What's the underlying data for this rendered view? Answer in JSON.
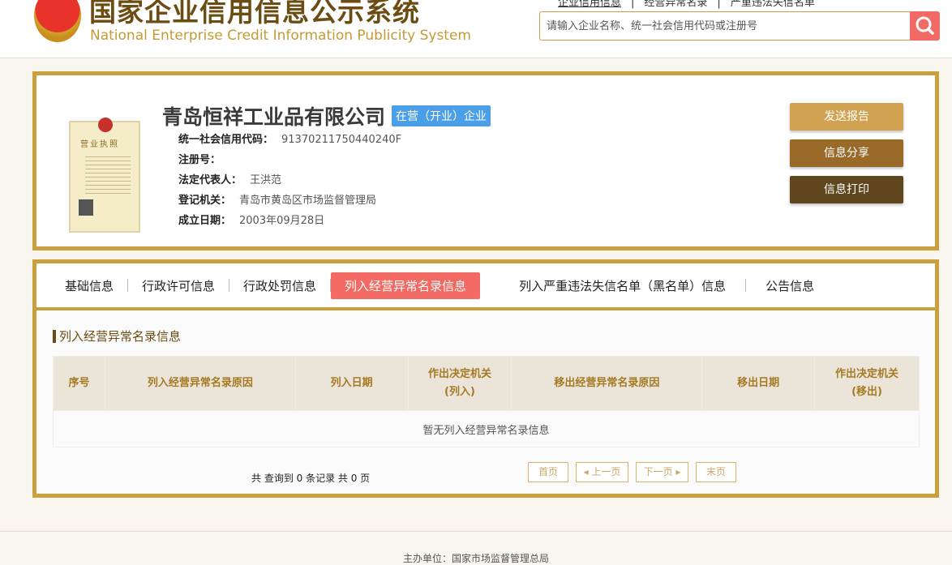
{
  "header": {
    "title_cn": "国家企业信用信息公示系统",
    "title_en": "National Enterprise Credit Information Publicity System",
    "links": [
      "企业信用信息",
      "经营异常名录",
      "严重违法失信名单"
    ],
    "search_placeholder": "请输入企业名称、统一社会信用代码或注册号"
  },
  "company": {
    "license_title": "营业执照",
    "name": "青岛恒祥工业品有限公司",
    "status": "在营（开业）企业",
    "fields": [
      {
        "label": "统一社会信用代码：",
        "value": "91370211750440240F"
      },
      {
        "label": "注册号：",
        "value": ""
      },
      {
        "label": "法定代表人：",
        "value": "王洪范"
      },
      {
        "label": "登记机关：",
        "value": "青岛市黄岛区市场监督管理局"
      },
      {
        "label": "成立日期：",
        "value": "2003年09月28日"
      }
    ],
    "buttons": [
      "发送报告",
      "信息分享",
      "信息打印"
    ]
  },
  "tabs": [
    "基础信息",
    "行政许可信息",
    "行政处罚信息",
    "列入经营异常名录信息",
    "列入严重违法失信名单（黑名单）信息",
    "公告信息"
  ],
  "section": {
    "title": "列入经营异常名录信息",
    "columns": [
      "序号",
      "列入经营异常名录原因",
      "列入日期",
      "作出决定机关\n(列入)",
      "移出经营异常名录原因",
      "移出日期",
      "作出决定机关\n(移出)"
    ],
    "empty": "暂无列入经营异常名录信息"
  },
  "pagination": {
    "summary": "共 查询到 0 条记录 共 0 页",
    "first": "首页",
    "prev": "◂ 上一页",
    "next": "下一页 ▸",
    "last": "末页"
  },
  "footer": "主办单位：国家市场监督管理总局"
}
